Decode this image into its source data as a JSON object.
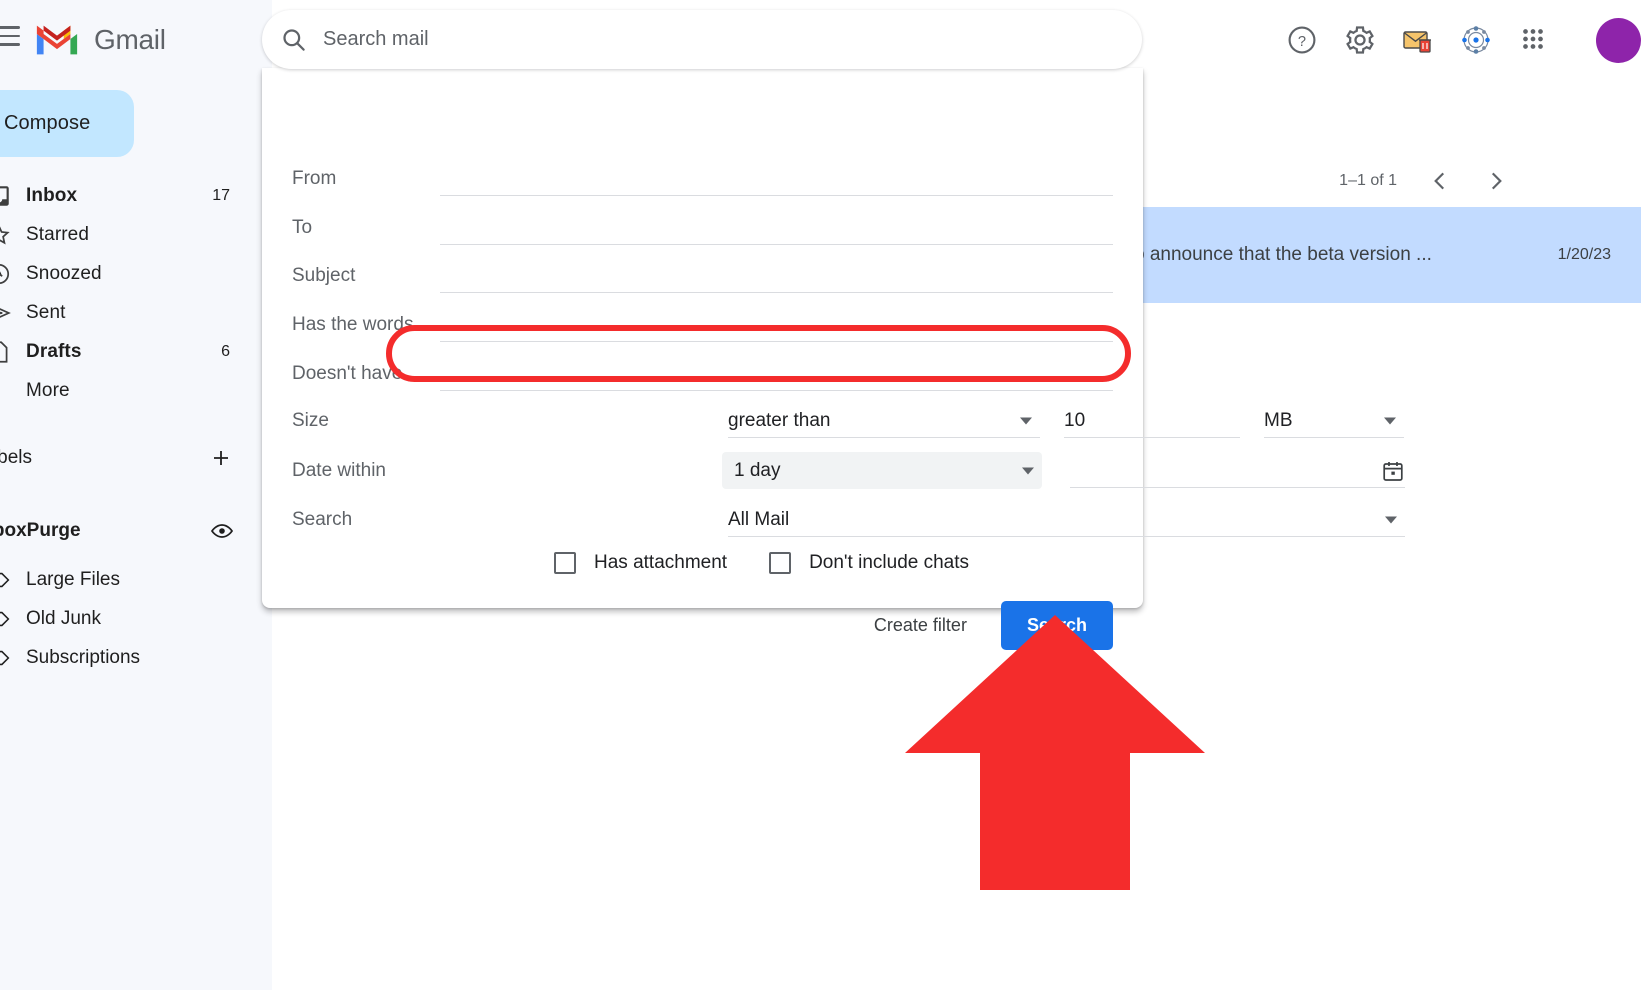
{
  "app": {
    "brand_name": "Gmail",
    "hamburger_icon": "hamburger-menu-icon",
    "logo_icon": "gmail-logo-icon"
  },
  "search": {
    "placeholder": "Search mail",
    "value": "",
    "icon": "search-icon"
  },
  "header_icons": [
    {
      "name": "help-icon",
      "label": "Support"
    },
    {
      "name": "gear-icon",
      "label": "Settings"
    },
    {
      "name": "mail-trash-icon",
      "label": "InboxPurge extension"
    },
    {
      "name": "network-icon",
      "label": "Extension"
    },
    {
      "name": "apps-grid-icon",
      "label": "Google apps"
    },
    {
      "name": "avatar",
      "label": "Account"
    }
  ],
  "sidebar": {
    "compose": {
      "label": "Compose",
      "icon": "pencil-icon"
    },
    "items": [
      {
        "label": "Inbox",
        "count": "17",
        "icon": "inbox-icon",
        "bold": true
      },
      {
        "label": "Starred",
        "count": "",
        "icon": "star-icon",
        "bold": false
      },
      {
        "label": "Snoozed",
        "count": "",
        "icon": "clock-icon",
        "bold": false
      },
      {
        "label": "Sent",
        "count": "",
        "icon": "send-icon",
        "bold": false
      },
      {
        "label": "Drafts",
        "count": "6",
        "icon": "draft-icon",
        "bold": true
      },
      {
        "label": "More",
        "count": "",
        "icon": "",
        "bold": false
      }
    ],
    "labels_header": {
      "label": "Labels",
      "add_icon": "plus-icon"
    },
    "group": {
      "label": "InboxPurge",
      "visibility_icon": "eye-icon"
    },
    "group_items": [
      {
        "label": "Large Files",
        "icon": "label-icon"
      },
      {
        "label": "Old Junk",
        "icon": "label-icon"
      },
      {
        "label": "Subscriptions",
        "icon": "label-icon"
      }
    ]
  },
  "maillist": {
    "pager_count": "1–1 of 1",
    "prev_icon": "chevron-left-icon",
    "next_icon": "chevron-right-icon",
    "rows": [
      {
        "snippet": "o announce that the beta version ...",
        "date": "1/20/23"
      }
    ]
  },
  "panel": {
    "fields": [
      {
        "key": "from",
        "label": "From",
        "value": ""
      },
      {
        "key": "to",
        "label": "To",
        "value": ""
      },
      {
        "key": "subject",
        "label": "Subject",
        "value": ""
      },
      {
        "key": "haswords",
        "label": "Has the words",
        "value": ""
      },
      {
        "key": "doesnt",
        "label": "Doesn't have",
        "value": ""
      }
    ],
    "size": {
      "label": "Size",
      "operator": "greater than",
      "value": "10",
      "unit": "MB"
    },
    "date": {
      "label": "Date within",
      "within": "1 day",
      "value": "",
      "calendar_icon": "calendar-icon"
    },
    "scope": {
      "label": "Search",
      "value": "All Mail"
    },
    "checkboxes": [
      {
        "label": "Has attachment",
        "checked": false
      },
      {
        "label": "Don't include chats",
        "checked": false
      }
    ],
    "create_filter_label": "Create filter",
    "search_button_label": "Search"
  },
  "annotations": {
    "highlight_box": {
      "target": "size-row",
      "color": "#f42c2c"
    },
    "arrow": {
      "target": "search-button",
      "direction": "up",
      "color": "#f42c2c"
    }
  },
  "colors": {
    "accent_blue": "#1a73e8",
    "compose_blue": "#c2e7ff",
    "row_selected": "#c2dbff",
    "sidebar_bg": "#f6f8fc",
    "annotation_red": "#f42c2c"
  }
}
